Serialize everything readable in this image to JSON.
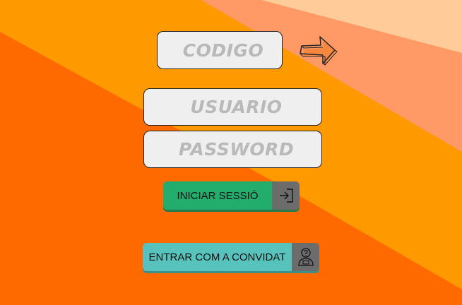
{
  "colors": {
    "bg_orange_dark": "#ff6a00",
    "bg_orange": "#ff9900",
    "bg_salmon": "#ff9966",
    "bg_peach": "#ffcc99",
    "login_button": "#22ad6d",
    "guest_button": "#58c3bd",
    "icon_tile": "#6c6c6c"
  },
  "form": {
    "code_placeholder": "CODIGO",
    "user_placeholder": "USUARIO",
    "password_placeholder": "PASSWORD",
    "submit_icon": "arrow-right-icon"
  },
  "buttons": {
    "login_label": "INICIAR SESSIÓ",
    "login_icon": "login-icon",
    "guest_label": "ENTRAR COM A CONVIDAT",
    "guest_icon": "guest-user-icon"
  }
}
